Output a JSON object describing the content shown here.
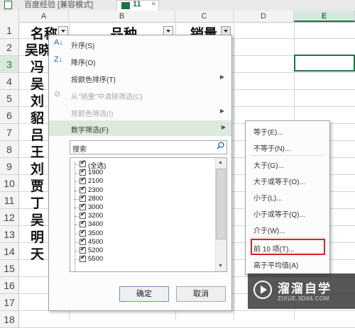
{
  "tabs": {
    "left_label": "百度经验 [兼容模式]",
    "active_label": "11",
    "close_glyph": "×"
  },
  "columns": [
    "A",
    "B",
    "C",
    "D",
    "E"
  ],
  "selected_column": "E",
  "rows": [
    "1",
    "2",
    "3",
    "4",
    "5",
    "6",
    "7",
    "8",
    "9",
    "10",
    "11",
    "12",
    "13",
    "14",
    "15",
    "16",
    "17",
    "18"
  ],
  "selected_row": "3",
  "header_row": {
    "a": "名称",
    "b": "品种",
    "c": "销量"
  },
  "column_a_visible": [
    "吴晓",
    "冯",
    "吴",
    "刘",
    "貂",
    "吕",
    "王",
    "刘",
    "贾",
    "丁",
    "吴",
    "明",
    "天"
  ],
  "menu": {
    "sort_asc": "升序(S)",
    "sort_desc": "降序(O)",
    "sort_by_color": "按颜色排序(T)",
    "clear_filter": "从\"销量\"中清除筛选(C)",
    "filter_by_color": "按颜色筛选(I)",
    "number_filter": "数字筛选(F)"
  },
  "search": {
    "placeholder": "搜索"
  },
  "filter_list": [
    {
      "label": "(全选)",
      "checked": true
    },
    {
      "label": "1900",
      "checked": true
    },
    {
      "label": "2100",
      "checked": true
    },
    {
      "label": "2300",
      "checked": true
    },
    {
      "label": "2800",
      "checked": true
    },
    {
      "label": "3000",
      "checked": true
    },
    {
      "label": "3200",
      "checked": true
    },
    {
      "label": "3400",
      "checked": true
    },
    {
      "label": "3500",
      "checked": true
    },
    {
      "label": "4500",
      "checked": true
    },
    {
      "label": "5200",
      "checked": true
    },
    {
      "label": "5500",
      "checked": true
    }
  ],
  "buttons": {
    "ok": "确定",
    "cancel": "取消"
  },
  "submenu": {
    "equals": "等于(E)...",
    "not_equals": "不等于(N)...",
    "greater": "大于(G)...",
    "greater_equal": "大于或等于(O)...",
    "less": "小于(L)...",
    "less_equal": "小于或等于(Q)...",
    "between": "介于(W)...",
    "top10": "前 10 项(T)...",
    "above_average": "高于平均值(A)"
  },
  "watermark": {
    "title": "溜溜自学",
    "url": "ZIXUE.3D66.COM"
  },
  "colors": {
    "accent": "#217346",
    "highlight": "#dde9dc",
    "red_box": "#d7202a"
  }
}
